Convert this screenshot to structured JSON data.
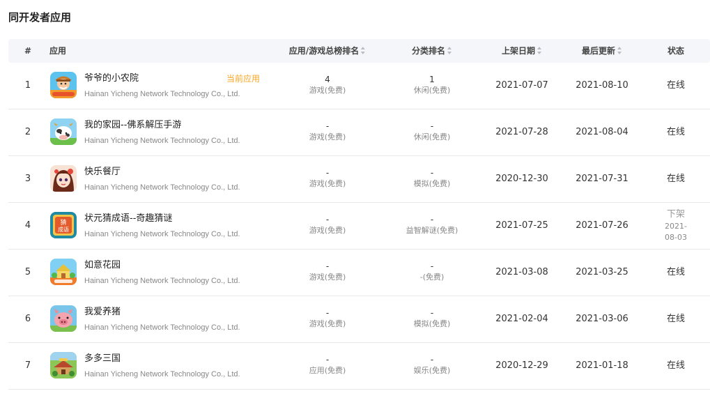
{
  "section": {
    "title": "同开发者应用"
  },
  "table": {
    "headers": {
      "index": "#",
      "app": "应用",
      "total_rank": "应用/游戏总榜排名",
      "category_rank": "分类排名",
      "release_date": "上架日期",
      "last_update": "最后更新",
      "status": "状态"
    },
    "current_app_tag": "当前应用",
    "rows": [
      {
        "index": "1",
        "name": "爷爷的小农院",
        "developer": "Hainan Yicheng Network Technology Co., Ltd.",
        "is_current": true,
        "icon": "farm-grandpa-app-icon",
        "total_rank": "4",
        "total_rank_cat": "游戏(免费)",
        "category_rank": "1",
        "category_rank_cat": "休闲(免费)",
        "release_date": "2021-07-07",
        "last_update": "2021-08-10",
        "status": "在线",
        "status_date": ""
      },
      {
        "index": "2",
        "name": "我的家园--佛系解压手游",
        "developer": "Hainan Yicheng Network Technology Co., Ltd.",
        "is_current": false,
        "icon": "cow-farm-app-icon",
        "total_rank": "-",
        "total_rank_cat": "游戏(免费)",
        "category_rank": "-",
        "category_rank_cat": "休闲(免费)",
        "release_date": "2021-07-28",
        "last_update": "2021-08-04",
        "status": "在线",
        "status_date": ""
      },
      {
        "index": "3",
        "name": "快乐餐厅",
        "developer": "Hainan Yicheng Network Technology Co., Ltd.",
        "is_current": false,
        "icon": "restaurant-girl-app-icon",
        "total_rank": "-",
        "total_rank_cat": "游戏(免费)",
        "category_rank": "-",
        "category_rank_cat": "模拟(免费)",
        "release_date": "2020-12-30",
        "last_update": "2021-07-31",
        "status": "在线",
        "status_date": ""
      },
      {
        "index": "4",
        "name": "状元猜成语--奇趣猜谜",
        "developer": "Hainan Yicheng Network Technology Co., Ltd.",
        "is_current": false,
        "icon": "idiom-puzzle-app-icon",
        "total_rank": "-",
        "total_rank_cat": "游戏(免费)",
        "category_rank": "-",
        "category_rank_cat": "益智解谜(免费)",
        "release_date": "2021-07-25",
        "last_update": "2021-07-26",
        "status": "下架",
        "status_date": "2021-08-03"
      },
      {
        "index": "5",
        "name": "如意花园",
        "developer": "Hainan Yicheng Network Technology Co., Ltd.",
        "is_current": false,
        "icon": "garden-house-app-icon",
        "total_rank": "-",
        "total_rank_cat": "游戏(免费)",
        "category_rank": "-",
        "category_rank_cat": "-(免费)",
        "release_date": "2021-03-08",
        "last_update": "2021-03-25",
        "status": "在线",
        "status_date": ""
      },
      {
        "index": "6",
        "name": "我爱养猪",
        "developer": "Hainan Yicheng Network Technology Co., Ltd.",
        "is_current": false,
        "icon": "pig-app-icon",
        "total_rank": "-",
        "total_rank_cat": "游戏(免费)",
        "category_rank": "-",
        "category_rank_cat": "模拟(免费)",
        "release_date": "2021-02-04",
        "last_update": "2021-03-06",
        "status": "在线",
        "status_date": ""
      },
      {
        "index": "7",
        "name": "多多三国",
        "developer": "Hainan Yicheng Network Technology Co., Ltd.",
        "is_current": false,
        "icon": "three-kingdoms-app-icon",
        "total_rank": "-",
        "total_rank_cat": "应用(免费)",
        "category_rank": "-",
        "category_rank_cat": "娱乐(免费)",
        "release_date": "2020-12-29",
        "last_update": "2021-01-18",
        "status": "在线",
        "status_date": ""
      }
    ]
  }
}
